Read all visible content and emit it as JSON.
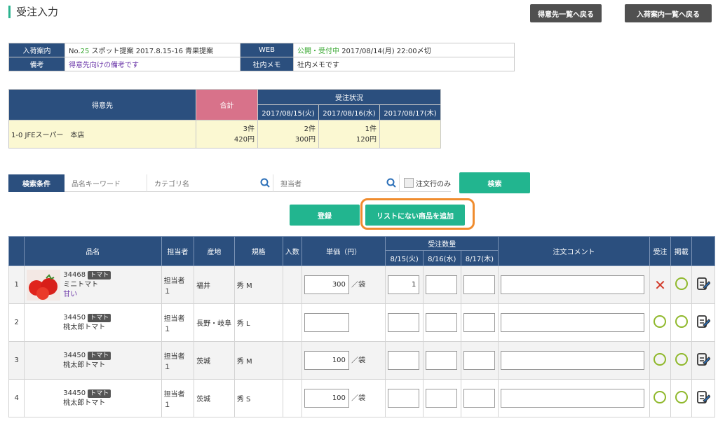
{
  "page": {
    "title": "受注入力"
  },
  "nav": {
    "back_customers": "得意先一覧へ戻る",
    "back_arrivals": "入荷案内一覧へ戻る"
  },
  "info": {
    "arrival_label": "入荷案内",
    "arrival_no_prefix": "No.",
    "arrival_no": "25",
    "arrival_title": "スポット提案 2017.8.15-16 青果提案",
    "web_label": "WEB",
    "web_status": "公開・受付中",
    "web_deadline": "2017/08/14(月) 22:00〆切",
    "note_label": "備考",
    "note_value": "得意先向けの備考です",
    "memo_label": "社内メモ",
    "memo_value": "社内メモです"
  },
  "customer_table": {
    "h_customer": "得意先",
    "h_total": "合計",
    "h_status": "受注状況",
    "dates": [
      "2017/08/15(火)",
      "2017/08/16(水)",
      "2017/08/17(木)"
    ],
    "row": {
      "name": "1-0  JFEスーパー　本店",
      "total_count": "3件",
      "total_amount": "420円",
      "d1_count": "2件",
      "d1_amount": "300円",
      "d2_count": "1件",
      "d2_amount": "120円"
    }
  },
  "search": {
    "label": "検索条件",
    "keyword_ph": "品名キーワード",
    "category_ph": "カテゴリ名",
    "person_ph": "担当者",
    "only_ordered": "注文行のみ",
    "search_btn": "検索"
  },
  "actions": {
    "register": "登録",
    "add_item": "リストにない商品を追加"
  },
  "orders": {
    "headers": {
      "name": "品名",
      "person": "担当者",
      "origin": "産地",
      "spec": "規格",
      "qty_per": "入数",
      "price": "単価（円）",
      "order_qty": "受注数量",
      "d1": "8/15(火)",
      "d2": "8/16(水)",
      "d3": "8/17(木)",
      "comment": "注文コメント",
      "accept": "受注",
      "publish": "掲載"
    },
    "unit": "／袋",
    "rows": [
      {
        "no": "1",
        "code": "34468",
        "tag": "トマト",
        "name": "ミニトマト",
        "sub": "甘い",
        "person": "担当者１",
        "origin": "福井",
        "spec": "秀 M",
        "price": "300",
        "unit_show": "／袋",
        "q1": "1"
      },
      {
        "no": "2",
        "code": "34450",
        "tag": "トマト",
        "name": "桃太郎トマト",
        "sub": "",
        "person": "担当者１",
        "origin": "長野・岐阜",
        "spec": "秀 L",
        "price": "",
        "unit_show": "",
        "q1": ""
      },
      {
        "no": "3",
        "code": "34450",
        "tag": "トマト",
        "name": "桃太郎トマト",
        "sub": "",
        "person": "担当者１",
        "origin": "茨城",
        "spec": "秀 M",
        "price": "100",
        "unit_show": "／袋",
        "q1": ""
      },
      {
        "no": "4",
        "code": "34450",
        "tag": "トマト",
        "name": "桃太郎トマト",
        "sub": "",
        "person": "担当者１",
        "origin": "茨城",
        "spec": "秀 S",
        "price": "100",
        "unit_show": "／袋",
        "q1": ""
      }
    ]
  }
}
